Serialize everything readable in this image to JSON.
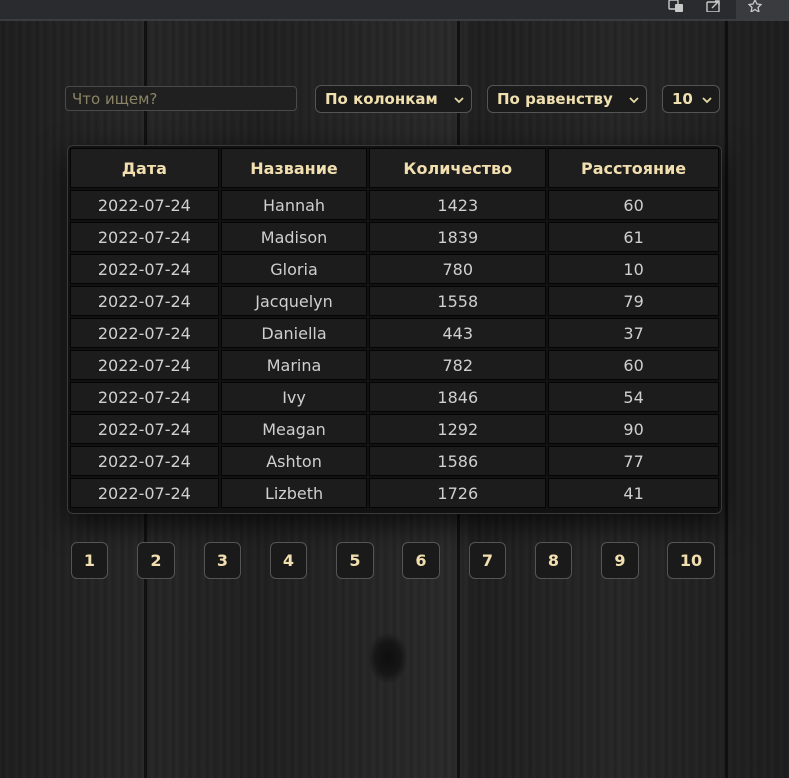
{
  "search": {
    "placeholder": "Что ищем?",
    "value": ""
  },
  "filters": {
    "column_select": {
      "selected": "По колонкам",
      "icon": "chevron-down-icon"
    },
    "condition_select": {
      "selected": "По равенству",
      "icon": "chevron-down-icon"
    },
    "rows_per_page_select": {
      "selected": "10",
      "icon": "chevron-down-icon"
    }
  },
  "table": {
    "headers": [
      "Дата",
      "Название",
      "Количество",
      "Расстояние"
    ],
    "rows": [
      [
        "2022-07-24",
        "Hannah",
        "1423",
        "60"
      ],
      [
        "2022-07-24",
        "Madison",
        "1839",
        "61"
      ],
      [
        "2022-07-24",
        "Gloria",
        "780",
        "10"
      ],
      [
        "2022-07-24",
        "Jacquelyn",
        "1558",
        "79"
      ],
      [
        "2022-07-24",
        "Daniella",
        "443",
        "37"
      ],
      [
        "2022-07-24",
        "Marina",
        "782",
        "60"
      ],
      [
        "2022-07-24",
        "Ivy",
        "1846",
        "54"
      ],
      [
        "2022-07-24",
        "Meagan",
        "1292",
        "90"
      ],
      [
        "2022-07-24",
        "Ashton",
        "1586",
        "77"
      ],
      [
        "2022-07-24",
        "Lizbeth",
        "1726",
        "41"
      ]
    ]
  },
  "pagination": {
    "pages": [
      "1",
      "2",
      "3",
      "4",
      "5",
      "6",
      "7",
      "8",
      "9",
      "10"
    ]
  },
  "browser_toolbar": {
    "icons": [
      "translate-icon",
      "share-icon",
      "bookmark-star-icon"
    ]
  },
  "colors": {
    "header_text": "#f2dfb0",
    "cell_text": "#cfcfcf",
    "background": "#1b1b1b"
  }
}
